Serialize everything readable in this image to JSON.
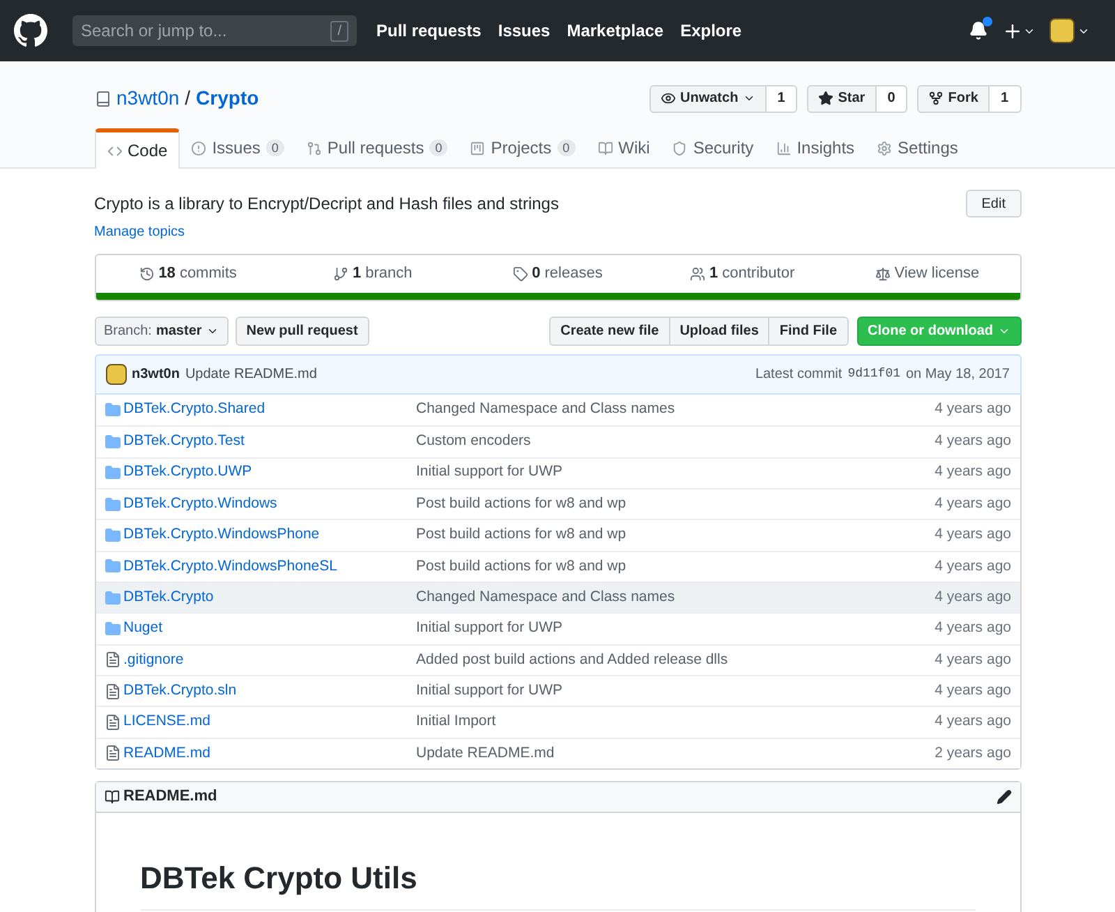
{
  "header": {
    "search_placeholder": "Search or jump to...",
    "search_key": "/",
    "nav": [
      "Pull requests",
      "Issues",
      "Marketplace",
      "Explore"
    ],
    "notification_unread": true
  },
  "repo": {
    "owner": "n3wt0n",
    "separator": "/",
    "name": "Crypto",
    "actions": [
      {
        "kind": "watch",
        "label": "Unwatch",
        "count": "1"
      },
      {
        "kind": "star",
        "label": "Star",
        "count": "0"
      },
      {
        "kind": "fork",
        "label": "Fork",
        "count": "1"
      }
    ]
  },
  "tabs": [
    {
      "kind": "code",
      "label": "Code",
      "selected": true
    },
    {
      "kind": "issues",
      "label": "Issues",
      "count": "0",
      "selected": false
    },
    {
      "kind": "pulls",
      "label": "Pull requests",
      "count": "0",
      "selected": false
    },
    {
      "kind": "projects",
      "label": "Projects",
      "count": "0",
      "selected": false
    },
    {
      "kind": "wiki",
      "label": "Wiki",
      "selected": false
    },
    {
      "kind": "security",
      "label": "Security",
      "selected": false
    },
    {
      "kind": "insights",
      "label": "Insights",
      "selected": false
    },
    {
      "kind": "settings",
      "label": "Settings",
      "selected": false
    }
  ],
  "description": "Crypto is a library to Encrypt/Decript and Hash files and strings",
  "edit_button": "Edit",
  "manage_topics": "Manage topics",
  "summary": [
    {
      "kind": "commits",
      "count": "18",
      "label": "commits"
    },
    {
      "kind": "branch",
      "count": "1",
      "label": "branch"
    },
    {
      "kind": "releases",
      "count": "0",
      "label": "releases"
    },
    {
      "kind": "contributors",
      "count": "1",
      "label": "contributor"
    },
    {
      "kind": "license",
      "label": "View license"
    }
  ],
  "language_bar": [
    {
      "color": "#178600",
      "level": 1
    }
  ],
  "file_nav": {
    "branch_label": "Branch:",
    "branch": "master",
    "new_pr": "New pull request",
    "buttons": [
      "Create new file",
      "Upload files",
      "Find File"
    ],
    "clone": "Clone or download"
  },
  "latest_commit": {
    "author": "n3wt0n",
    "message": "Update README.md",
    "prefix": "Latest commit",
    "sha": "9d11f01",
    "date": "on May 18, 2017"
  },
  "files": [
    {
      "kind": "dir",
      "name": "DBTek.Crypto.Shared",
      "message": "Changed Namespace and Class names",
      "age": "4 years ago",
      "highlighted": false
    },
    {
      "kind": "dir",
      "name": "DBTek.Crypto.Test",
      "message": "Custom encoders",
      "age": "4 years ago",
      "highlighted": false
    },
    {
      "kind": "dir",
      "name": "DBTek.Crypto.UWP",
      "message": "Initial support for UWP",
      "age": "4 years ago",
      "highlighted": false
    },
    {
      "kind": "dir",
      "name": "DBTek.Crypto.Windows",
      "message": "Post build actions for w8 and wp",
      "age": "4 years ago",
      "highlighted": false
    },
    {
      "kind": "dir",
      "name": "DBTek.Crypto.WindowsPhone",
      "message": "Post build actions for w8 and wp",
      "age": "4 years ago",
      "highlighted": false
    },
    {
      "kind": "dir",
      "name": "DBTek.Crypto.WindowsPhoneSL",
      "message": "Post build actions for w8 and wp",
      "age": "4 years ago",
      "highlighted": false
    },
    {
      "kind": "dir",
      "name": "DBTek.Crypto",
      "message": "Changed Namespace and Class names",
      "age": "4 years ago",
      "highlighted": true
    },
    {
      "kind": "dir",
      "name": "Nuget",
      "message": "Initial support for UWP",
      "age": "4 years ago",
      "highlighted": false
    },
    {
      "kind": "file",
      "name": ".gitignore",
      "message": "Added post build actions and Added release dlls",
      "age": "4 years ago",
      "highlighted": false
    },
    {
      "kind": "file",
      "name": "DBTek.Crypto.sln",
      "message": "Initial support for UWP",
      "age": "4 years ago",
      "highlighted": false
    },
    {
      "kind": "file",
      "name": "LICENSE.md",
      "message": "Initial Import",
      "age": "4 years ago",
      "highlighted": false
    },
    {
      "kind": "file",
      "name": "README.md",
      "message": "Update README.md",
      "age": "2 years ago",
      "highlighted": false
    }
  ],
  "readme": {
    "filename": "README.md",
    "heading": "DBTek Crypto Utils"
  }
}
